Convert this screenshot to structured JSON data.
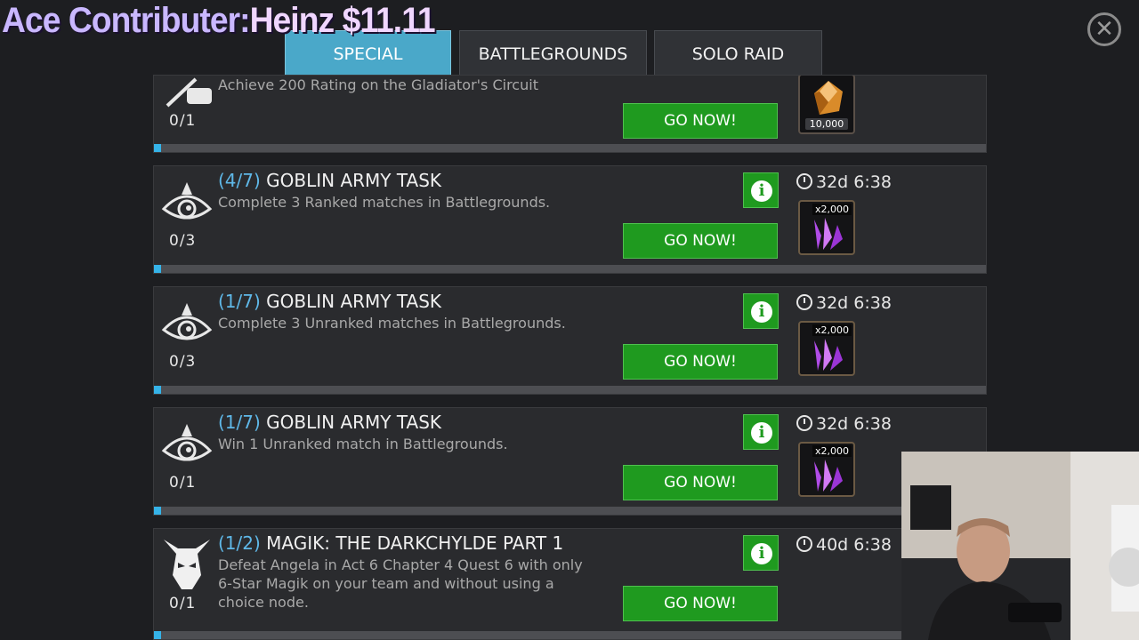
{
  "overlay": {
    "label": "Ace Contributer:",
    "amount": "Heinz $11.11"
  },
  "tabs": [
    {
      "label": "SPECIAL",
      "active": true
    },
    {
      "label": "BATTLEGROUNDS",
      "active": false
    },
    {
      "label": "SOLO RAID",
      "active": false
    }
  ],
  "close_icon": "close-icon",
  "go_label": "GO NOW!",
  "quests": [
    {
      "step": "",
      "title": "",
      "desc": "Achieve 200 Rating on the Gladiator's Circuit",
      "progress": "0/1",
      "progress_fraction": 0,
      "timer": "",
      "reward_qty": "10,000",
      "reward_icon": "gold-gem-icon"
    },
    {
      "step": "(4/7)",
      "title": "GOBLIN ARMY TASK",
      "desc": "Complete 3 Ranked matches in Battlegrounds.",
      "progress": "0/3",
      "progress_fraction": 0,
      "timer": "32d 6:38",
      "reward_qty": "x2,000",
      "reward_icon": "crystal-shards-icon"
    },
    {
      "step": "(1/7)",
      "title": "GOBLIN ARMY TASK",
      "desc": "Complete 3 Unranked matches in Battlegrounds.",
      "progress": "0/3",
      "progress_fraction": 0,
      "timer": "32d 6:38",
      "reward_qty": "x2,000",
      "reward_icon": "crystal-shards-icon"
    },
    {
      "step": "(1/7)",
      "title": "GOBLIN ARMY TASK",
      "desc": "Win 1 Unranked match in Battlegrounds.",
      "progress": "0/1",
      "progress_fraction": 0,
      "timer": "32d 6:38",
      "reward_qty": "x2,000",
      "reward_icon": "crystal-shards-icon"
    },
    {
      "step": "(1/2)",
      "title": "MAGIK: THE DARKCHYLDE PART 1",
      "desc_lines": [
        "Defeat Angela in Act 6 Chapter 4 Quest 6 with only",
        "6-Star Magik on your team and without using a",
        "choice node."
      ],
      "progress": "0/1",
      "progress_fraction": 0,
      "timer": "40d 6:38",
      "reward_qty": "",
      "reward_icon": ""
    }
  ],
  "colors": {
    "background": "#1d1e21",
    "tab_active": "#4aa8c9",
    "go_button": "#1f9a1f",
    "step_text": "#5fb8e8",
    "progress_dot": "#35b3e8"
  }
}
